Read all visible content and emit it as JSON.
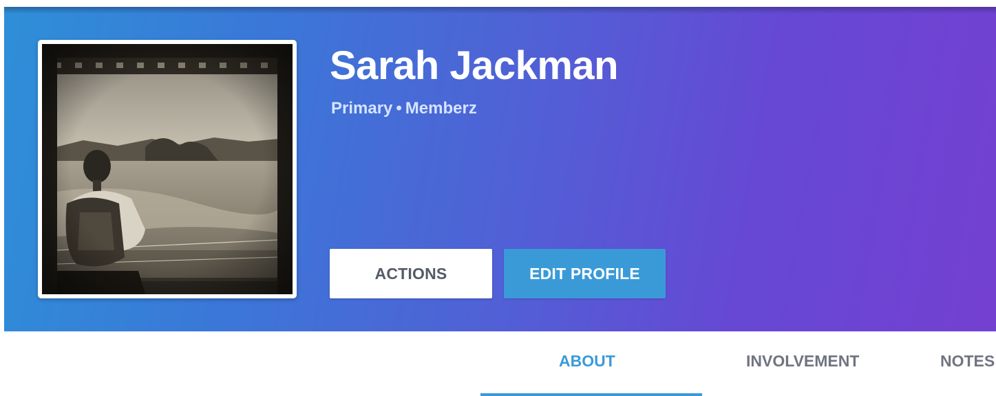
{
  "profile": {
    "name": "Sarah Jackman",
    "role": "Primary",
    "separator": "•",
    "group": "Memberz"
  },
  "buttons": {
    "actions_label": "ACTIONS",
    "edit_label": "EDIT PROFILE"
  },
  "tabs": [
    {
      "label": "ABOUT",
      "active": true
    },
    {
      "label": "INVOLVEMENT",
      "active": false
    },
    {
      "label": "NOTES",
      "active": false
    }
  ],
  "colors": {
    "accent": "#3a9ad8",
    "gradient_start": "#2e8fd8",
    "gradient_end": "#7440d2"
  }
}
